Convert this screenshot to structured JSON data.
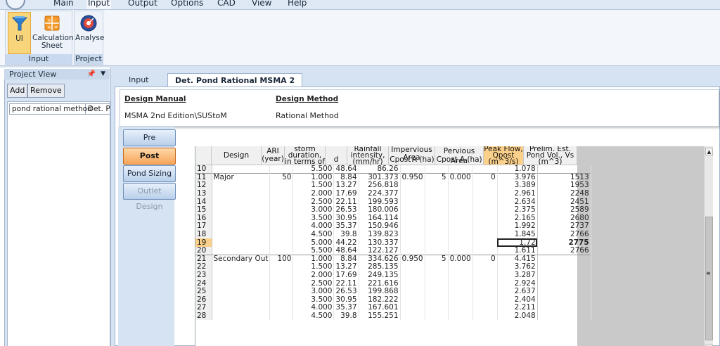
{
  "menu": {
    "items": [
      "Main",
      "Input",
      "Output",
      "Options",
      "CAD",
      "View",
      "Help"
    ],
    "active_index": 1
  },
  "ribbon": {
    "ui_label": "UI",
    "calc_label_1": "Calculation",
    "calc_label_2": "Sheet",
    "analyse_label": "Analyse",
    "group_input": "Input",
    "group_project": "Project"
  },
  "project_view": {
    "title": "Project View",
    "add_label": "Add",
    "remove_label": "Remove",
    "items": [
      "pond rational method",
      "Det. Pc"
    ]
  },
  "tabs": [
    "Input",
    "Det. Pond Rational MSMA 2"
  ],
  "design": {
    "manual_header": "Design Manual",
    "manual_value": "MSMA 2nd Edition\\SUStoM",
    "method_header": "Design Method",
    "method_value": "Rational Method"
  },
  "side_buttons": [
    "Pre",
    "Post",
    "Pond Sizing",
    "Outlet Design"
  ],
  "grid": {
    "headers": {
      "design_storm": "Design Storm",
      "ari": [
        "ARI",
        "(year)"
      ],
      "storm_duration": [
        "storm duration,",
        "in terms of",
        "td"
      ],
      "d": "d",
      "rainfall": [
        "Rainfall",
        "intensity,",
        "(mm/hr)"
      ],
      "impervious": "Impervious Area",
      "pervious": "Pervious Area",
      "cpost": "Cpost",
      "a_ha": "A (ha)",
      "peak_flow": [
        "Peak Flow,",
        "Qpost",
        "(m^3/s)"
      ],
      "prelim": [
        "Prelim. Est.",
        "Pond Vol., Vs",
        "(m^3)"
      ]
    },
    "rows": [
      {
        "n": "10",
        "storm": "",
        "ari": "",
        "td": "5.500",
        "d": "48.64",
        "i": "86.26",
        "cimp": "",
        "aimp": "",
        "cper": "",
        "aper": "",
        "q": "1.078",
        "vs": ""
      },
      {
        "n": "11",
        "storm": "Major",
        "ari": "50",
        "td": "1.000",
        "d": "8.84",
        "i": "301.373",
        "cimp": "0.950",
        "aimp": "5",
        "cper": "0.000",
        "aper": "0",
        "q": "3.976",
        "vs": "1513"
      },
      {
        "n": "12",
        "storm": "",
        "ari": "",
        "td": "1.500",
        "d": "13.27",
        "i": "256.818",
        "cimp": "",
        "aimp": "",
        "cper": "",
        "aper": "",
        "q": "3.389",
        "vs": "1953"
      },
      {
        "n": "13",
        "storm": "",
        "ari": "",
        "td": "2.000",
        "d": "17.69",
        "i": "224.377",
        "cimp": "",
        "aimp": "",
        "cper": "",
        "aper": "",
        "q": "2.961",
        "vs": "2248"
      },
      {
        "n": "14",
        "storm": "",
        "ari": "",
        "td": "2.500",
        "d": "22.11",
        "i": "199.593",
        "cimp": "",
        "aimp": "",
        "cper": "",
        "aper": "",
        "q": "2.634",
        "vs": "2451"
      },
      {
        "n": "15",
        "storm": "",
        "ari": "",
        "td": "3.000",
        "d": "26.53",
        "i": "180.006",
        "cimp": "",
        "aimp": "",
        "cper": "",
        "aper": "",
        "q": "2.375",
        "vs": "2589"
      },
      {
        "n": "16",
        "storm": "",
        "ari": "",
        "td": "3.500",
        "d": "30.95",
        "i": "164.114",
        "cimp": "",
        "aimp": "",
        "cper": "",
        "aper": "",
        "q": "2.165",
        "vs": "2680"
      },
      {
        "n": "17",
        "storm": "",
        "ari": "",
        "td": "4.000",
        "d": "35.37",
        "i": "150.946",
        "cimp": "",
        "aimp": "",
        "cper": "",
        "aper": "",
        "q": "1.992",
        "vs": "2737"
      },
      {
        "n": "18",
        "storm": "",
        "ari": "",
        "td": "4.500",
        "d": "39.8",
        "i": "139.823",
        "cimp": "",
        "aimp": "",
        "cper": "",
        "aper": "",
        "q": "1.845",
        "vs": "2766"
      },
      {
        "n": "19",
        "storm": "",
        "ari": "",
        "td": "5.000",
        "d": "44.22",
        "i": "130.337",
        "cimp": "",
        "aimp": "",
        "cper": "",
        "aper": "",
        "q": "1.72",
        "vs": "2775"
      },
      {
        "n": "20",
        "storm": "",
        "ari": "",
        "td": "5.500",
        "d": "48.64",
        "i": "122.127",
        "cimp": "",
        "aimp": "",
        "cper": "",
        "aper": "",
        "q": "1.611",
        "vs": "2766"
      },
      {
        "n": "21",
        "storm": "Secondary Out",
        "ari": "100",
        "td": "1.000",
        "d": "8.84",
        "i": "334.626",
        "cimp": "0.950",
        "aimp": "5",
        "cper": "0.000",
        "aper": "0",
        "q": "4.415",
        "vs": ""
      },
      {
        "n": "22",
        "storm": "",
        "ari": "",
        "td": "1.500",
        "d": "13.27",
        "i": "285.135",
        "cimp": "",
        "aimp": "",
        "cper": "",
        "aper": "",
        "q": "3.762",
        "vs": ""
      },
      {
        "n": "23",
        "storm": "",
        "ari": "",
        "td": "2.000",
        "d": "17.69",
        "i": "249.135",
        "cimp": "",
        "aimp": "",
        "cper": "",
        "aper": "",
        "q": "3.287",
        "vs": ""
      },
      {
        "n": "24",
        "storm": "",
        "ari": "",
        "td": "2.500",
        "d": "22.11",
        "i": "221.616",
        "cimp": "",
        "aimp": "",
        "cper": "",
        "aper": "",
        "q": "2.924",
        "vs": ""
      },
      {
        "n": "25",
        "storm": "",
        "ari": "",
        "td": "3.000",
        "d": "26.53",
        "i": "199.868",
        "cimp": "",
        "aimp": "",
        "cper": "",
        "aper": "",
        "q": "2.637",
        "vs": ""
      },
      {
        "n": "26",
        "storm": "",
        "ari": "",
        "td": "3.500",
        "d": "30.95",
        "i": "182.222",
        "cimp": "",
        "aimp": "",
        "cper": "",
        "aper": "",
        "q": "2.404",
        "vs": ""
      },
      {
        "n": "27",
        "storm": "",
        "ari": "",
        "td": "4.000",
        "d": "35.37",
        "i": "167.601",
        "cimp": "",
        "aimp": "",
        "cper": "",
        "aper": "",
        "q": "2.211",
        "vs": ""
      },
      {
        "n": "28",
        "storm": "",
        "ari": "",
        "td": "4.500",
        "d": "39.8",
        "i": "155.251",
        "cimp": "",
        "aimp": "",
        "cper": "",
        "aper": "",
        "q": "2.048",
        "vs": ""
      }
    ],
    "selected_row": "19",
    "colors": {
      "selected_row_header": "#fbd08a",
      "active_button": "#f7a45a"
    }
  }
}
